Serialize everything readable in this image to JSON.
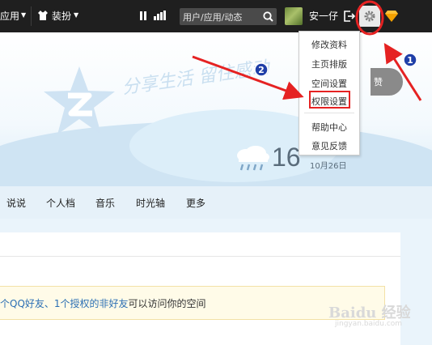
{
  "topbar": {
    "app_label": "应用",
    "decorate_label": "装扮",
    "search_placeholder": "用户/应用/动态",
    "username": "安一仔",
    "icons": [
      "shirt-icon",
      "pause-icon",
      "bars-icon",
      "search-icon",
      "exit-icon",
      "gear-icon",
      "diamond-icon"
    ]
  },
  "banner": {
    "slogan": "分享生活 留住感动",
    "praise_label": "赞",
    "weather": {
      "temperature": "16",
      "date": "10月26日"
    }
  },
  "nav": {
    "items": [
      "说说",
      "个人档",
      "音乐",
      "时光轴",
      "更多"
    ]
  },
  "notice": {
    "part1": "个QQ好友、1个授权的非好友",
    "part2": "可以访问你的空间"
  },
  "dropdown": {
    "items": [
      "修改资料",
      "主页排版",
      "空间设置",
      "权限设置",
      "帮助中心",
      "意见反馈"
    ],
    "highlighted": "权限设置"
  },
  "annotations": {
    "step1": "1",
    "step2": "2"
  },
  "watermark": {
    "brand": "Baidu 经验",
    "url": "jingyan.baidu.com"
  },
  "colors": {
    "topbar": "#1f1f1f",
    "annotation_red": "#e52222",
    "badge_blue": "#1f3fa8",
    "notice_link": "#2b6fb4"
  }
}
